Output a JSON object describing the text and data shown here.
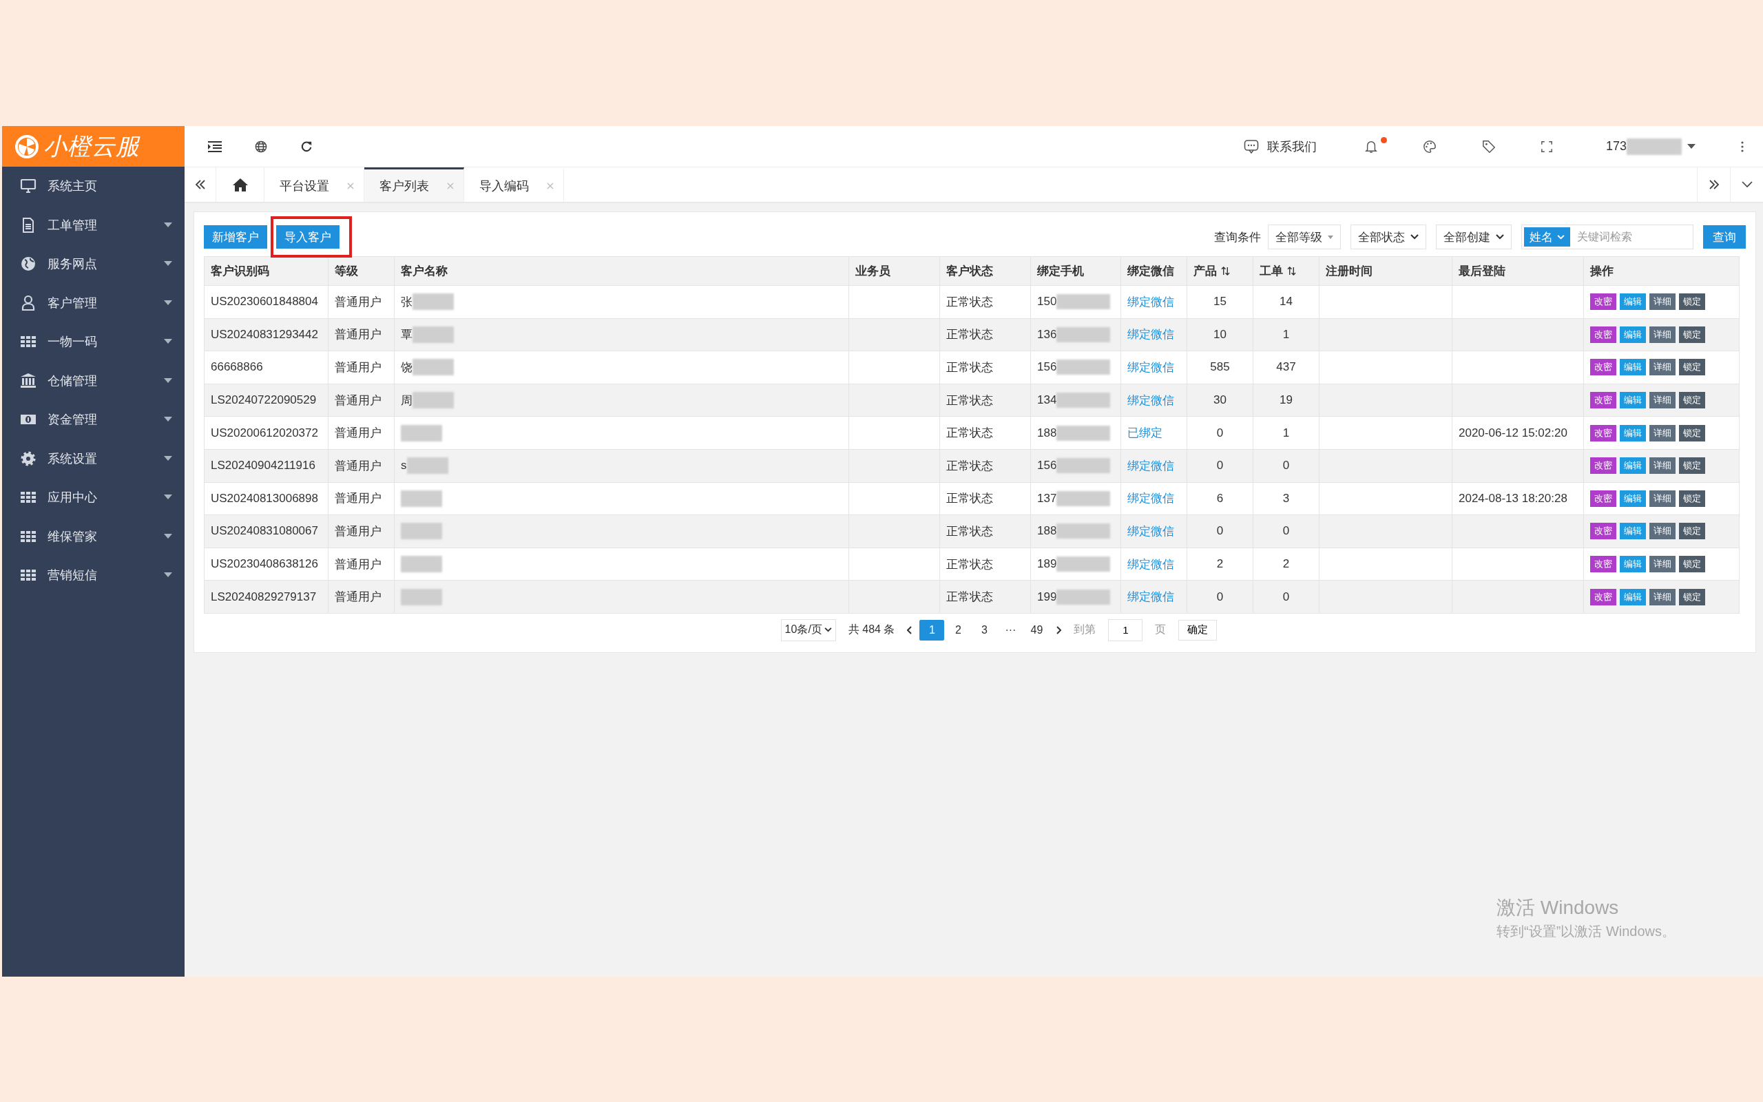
{
  "logo": {
    "text": "小橙云服"
  },
  "sidebar": {
    "items": [
      {
        "label": "系统主页",
        "kind": "monitor",
        "has_submenu": false
      },
      {
        "label": "工单管理",
        "kind": "document",
        "has_submenu": true
      },
      {
        "label": "服务网点",
        "kind": "globe",
        "has_submenu": true
      },
      {
        "label": "客户管理",
        "kind": "user",
        "has_submenu": true
      },
      {
        "label": "一物一码",
        "kind": "grid",
        "has_submenu": true
      },
      {
        "label": "仓储管理",
        "kind": "bank",
        "has_submenu": true
      },
      {
        "label": "资金管理",
        "kind": "money",
        "has_submenu": true
      },
      {
        "label": "系统设置",
        "kind": "gear",
        "has_submenu": true
      },
      {
        "label": "应用中心",
        "kind": "grid",
        "has_submenu": true
      },
      {
        "label": "维保管家",
        "kind": "grid",
        "has_submenu": true
      },
      {
        "label": "营销短信",
        "kind": "grid",
        "has_submenu": true
      }
    ]
  },
  "header": {
    "contact": "联系我们",
    "notification_dot": true,
    "user": "173"
  },
  "tabs": [
    {
      "label": "平台设置",
      "selected": false
    },
    {
      "label": "客户列表",
      "selected": true
    },
    {
      "label": "导入编码",
      "selected": false
    }
  ],
  "toolbar": {
    "buttons": [
      {
        "label": "新增客户",
        "highlighted": false
      },
      {
        "label": "导入客户",
        "highlighted": true
      }
    ],
    "filter_label": "查询条件",
    "selects": [
      "全部等级",
      "全部状态",
      "全部创建"
    ],
    "field_select": "姓名",
    "search": {
      "placeholder": "关键词检索"
    },
    "query_button": "查询"
  },
  "table": {
    "columns": [
      {
        "label": "客户识别码",
        "sortable": false
      },
      {
        "label": "等级",
        "sortable": false
      },
      {
        "label": "客户名称",
        "sortable": false
      },
      {
        "label": "业务员",
        "sortable": false
      },
      {
        "label": "客户状态",
        "sortable": false
      },
      {
        "label": "绑定手机",
        "sortable": false
      },
      {
        "label": "绑定微信",
        "sortable": false
      },
      {
        "label": "产品",
        "sortable": true
      },
      {
        "label": "工单",
        "sortable": true
      },
      {
        "label": "注册时间",
        "sortable": false
      },
      {
        "label": "最后登陆",
        "sortable": false
      },
      {
        "label": "操作",
        "sortable": false
      }
    ],
    "rows": [
      {
        "id": "US20230601848804",
        "level": "普通用户",
        "name": "张",
        "status": "正常状态",
        "phone": "150",
        "wechat": "绑定微信",
        "products": "15",
        "orders": "14",
        "actions": [
          {
            "label": "改密",
            "color": "#b03ccc"
          },
          {
            "label": "编辑",
            "color": "#1e9be0"
          },
          {
            "label": "详细",
            "color": "#5e6e7e"
          },
          {
            "label": "锁定",
            "color": "#4e5b68"
          }
        ]
      },
      {
        "id": "US20240831293442",
        "level": "普通用户",
        "name": "覃",
        "status": "正常状态",
        "phone": "136",
        "wechat": "绑定微信",
        "products": "10",
        "orders": "1",
        "actions": [
          {
            "label": "改密",
            "color": "#b03ccc"
          },
          {
            "label": "编辑",
            "color": "#1e9be0"
          },
          {
            "label": "详细",
            "color": "#5e6e7e"
          },
          {
            "label": "锁定",
            "color": "#4e5b68"
          }
        ]
      },
      {
        "id": "66668866",
        "level": "普通用户",
        "name": "饶",
        "status": "正常状态",
        "phone": "156",
        "wechat": "绑定微信",
        "products": "585",
        "orders": "437",
        "actions": [
          {
            "label": "改密",
            "color": "#b03ccc"
          },
          {
            "label": "编辑",
            "color": "#1e9be0"
          },
          {
            "label": "详细",
            "color": "#5e6e7e"
          },
          {
            "label": "锁定",
            "color": "#4e5b68"
          }
        ]
      },
      {
        "id": "LS20240722090529",
        "level": "普通用户",
        "name": "周",
        "status": "正常状态",
        "phone": "134",
        "wechat": "绑定微信",
        "products": "30",
        "orders": "19",
        "actions": [
          {
            "label": "改密",
            "color": "#b03ccc"
          },
          {
            "label": "编辑",
            "color": "#1e9be0"
          },
          {
            "label": "详细",
            "color": "#5e6e7e"
          },
          {
            "label": "锁定",
            "color": "#4e5b68"
          }
        ]
      },
      {
        "id": "US20200612020372",
        "level": "普通用户",
        "status": "正常状态",
        "phone": "188",
        "wechat": "已绑定",
        "products": "0",
        "orders": "1",
        "last_login": "2020-06-12 15:02:20",
        "actions": [
          {
            "label": "改密",
            "color": "#b03ccc"
          },
          {
            "label": "编辑",
            "color": "#1e9be0"
          },
          {
            "label": "详细",
            "color": "#5e6e7e"
          },
          {
            "label": "锁定",
            "color": "#4e5b68"
          }
        ]
      },
      {
        "id": "LS20240904211916",
        "level": "普通用户",
        "name": "s",
        "status": "正常状态",
        "phone": "156",
        "wechat": "绑定微信",
        "products": "0",
        "orders": "0",
        "actions": [
          {
            "label": "改密",
            "color": "#b03ccc"
          },
          {
            "label": "编辑",
            "color": "#1e9be0"
          },
          {
            "label": "详细",
            "color": "#5e6e7e"
          },
          {
            "label": "锁定",
            "color": "#4e5b68"
          }
        ]
      },
      {
        "id": "US20240813006898",
        "level": "普通用户",
        "status": "正常状态",
        "phone": "137",
        "wechat": "绑定微信",
        "products": "6",
        "orders": "3",
        "last_login": "2024-08-13 18:20:28",
        "actions": [
          {
            "label": "改密",
            "color": "#b03ccc"
          },
          {
            "label": "编辑",
            "color": "#1e9be0"
          },
          {
            "label": "详细",
            "color": "#5e6e7e"
          },
          {
            "label": "锁定",
            "color": "#4e5b68"
          }
        ]
      },
      {
        "id": "US20240831080067",
        "level": "普通用户",
        "status": "正常状态",
        "phone": "188",
        "wechat": "绑定微信",
        "products": "0",
        "orders": "0",
        "actions": [
          {
            "label": "改密",
            "color": "#b03ccc"
          },
          {
            "label": "编辑",
            "color": "#1e9be0"
          },
          {
            "label": "详细",
            "color": "#5e6e7e"
          },
          {
            "label": "锁定",
            "color": "#4e5b68"
          }
        ]
      },
      {
        "id": "US20230408638126",
        "level": "普通用户",
        "status": "正常状态",
        "phone": "189",
        "wechat": "绑定微信",
        "products": "2",
        "orders": "2",
        "actions": [
          {
            "label": "改密",
            "color": "#b03ccc"
          },
          {
            "label": "编辑",
            "color": "#1e9be0"
          },
          {
            "label": "详细",
            "color": "#5e6e7e"
          },
          {
            "label": "锁定",
            "color": "#4e5b68"
          }
        ]
      },
      {
        "id": "LS20240829279137",
        "level": "普通用户",
        "status": "正常状态",
        "phone": "199",
        "wechat": "绑定微信",
        "products": "0",
        "orders": "0",
        "actions": [
          {
            "label": "改密",
            "color": "#b03ccc"
          },
          {
            "label": "编辑",
            "color": "#1e9be0"
          },
          {
            "label": "详细",
            "color": "#5e6e7e"
          },
          {
            "label": "锁定",
            "color": "#4e5b68"
          }
        ]
      }
    ]
  },
  "pagination": {
    "page_size": "10条/页",
    "total": "共 484 条",
    "pages": [
      {
        "label": "1",
        "selected": true
      },
      {
        "label": "2",
        "selected": false
      },
      {
        "label": "3",
        "selected": false
      },
      {
        "label": "···",
        "selected": false
      },
      {
        "label": "49",
        "selected": false
      }
    ],
    "goto_label": "到第",
    "goto_value": "1",
    "page_unit": "页",
    "confirm": "确定"
  },
  "activation_notice": {
    "title": "激活 Windows",
    "subtitle": "转到“设置”以激活 Windows。"
  }
}
